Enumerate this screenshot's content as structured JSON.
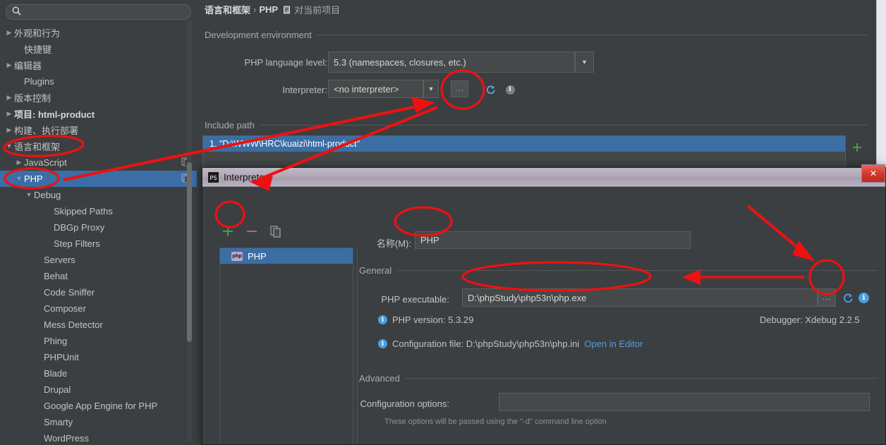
{
  "search": {
    "value": "",
    "placeholder": "",
    "icon": "search-icon"
  },
  "sidebar": {
    "items": [
      {
        "label": "外观和行为",
        "arrow": "▶",
        "indent": 0,
        "selected": false,
        "bold": false
      },
      {
        "label": "快捷键",
        "arrow": "",
        "indent": 1,
        "selected": false,
        "bold": false
      },
      {
        "label": "编辑器",
        "arrow": "▶",
        "indent": 0,
        "selected": false,
        "bold": false
      },
      {
        "label": "Plugins",
        "arrow": "",
        "indent": 1,
        "selected": false,
        "bold": false
      },
      {
        "label": "版本控制",
        "arrow": "▶",
        "indent": 0,
        "selected": false,
        "bold": false
      },
      {
        "label": "项目: html-product",
        "arrow": "▶",
        "indent": 0,
        "selected": false,
        "bold": true
      },
      {
        "label": "构建、执行部署",
        "arrow": "▶",
        "indent": 0,
        "selected": false,
        "bold": false
      },
      {
        "label": "语言和框架",
        "arrow": "▼",
        "indent": 0,
        "selected": false,
        "bold": false
      },
      {
        "label": "JavaScript",
        "arrow": "▶",
        "indent": 1,
        "selected": false,
        "bold": false,
        "tail": "copy-icon"
      },
      {
        "label": "PHP",
        "arrow": "▼",
        "indent": 1,
        "selected": true,
        "bold": false,
        "tail": "copy-icon"
      },
      {
        "label": "Debug",
        "arrow": "▼",
        "indent": 2,
        "selected": false,
        "bold": false
      },
      {
        "label": "Skipped Paths",
        "arrow": "",
        "indent": 4,
        "selected": false,
        "bold": false
      },
      {
        "label": "DBGp Proxy",
        "arrow": "",
        "indent": 4,
        "selected": false,
        "bold": false
      },
      {
        "label": "Step Filters",
        "arrow": "",
        "indent": 4,
        "selected": false,
        "bold": false
      },
      {
        "label": "Servers",
        "arrow": "",
        "indent": 3,
        "selected": false,
        "bold": false
      },
      {
        "label": "Behat",
        "arrow": "",
        "indent": 3,
        "selected": false,
        "bold": false
      },
      {
        "label": "Code Sniffer",
        "arrow": "",
        "indent": 3,
        "selected": false,
        "bold": false
      },
      {
        "label": "Composer",
        "arrow": "",
        "indent": 3,
        "selected": false,
        "bold": false
      },
      {
        "label": "Mess Detector",
        "arrow": "",
        "indent": 3,
        "selected": false,
        "bold": false
      },
      {
        "label": "Phing",
        "arrow": "",
        "indent": 3,
        "selected": false,
        "bold": false
      },
      {
        "label": "PHPUnit",
        "arrow": "",
        "indent": 3,
        "selected": false,
        "bold": false
      },
      {
        "label": "Blade",
        "arrow": "",
        "indent": 3,
        "selected": false,
        "bold": false
      },
      {
        "label": "Drupal",
        "arrow": "",
        "indent": 3,
        "selected": false,
        "bold": false
      },
      {
        "label": "Google App Engine for PHP",
        "arrow": "",
        "indent": 3,
        "selected": false,
        "bold": false
      },
      {
        "label": "Smarty",
        "arrow": "",
        "indent": 3,
        "selected": false,
        "bold": false
      },
      {
        "label": "WordPress",
        "arrow": "",
        "indent": 3,
        "selected": false,
        "bold": false
      }
    ]
  },
  "breadcrumb": {
    "parent": "语言和框架",
    "separator": "›",
    "current": "PHP",
    "scope": "对当前项目",
    "scope_icon": "project-scope-icon"
  },
  "main": {
    "dev_env_group": "Development environment",
    "lang_level_label": "PHP language level:",
    "lang_level_value": "5.3 (namespaces, closures, etc.)",
    "interpreter_label": "Interpreter:",
    "interpreter_value": "<no interpreter>",
    "browse_dots": "...",
    "include_path_group": "Include path",
    "include_path_rows": [
      "1. \"D:\\WWW\\HRC\\kuaizi\\html-product\""
    ],
    "add_symbol": "+"
  },
  "dialog": {
    "title": "Interpreters",
    "title_icon": "php-storm-icon",
    "close_label": "✕",
    "toolbar": {
      "add": "+",
      "remove": "−",
      "copy": "copy-icon"
    },
    "list": [
      {
        "label": "PHP",
        "icon": "php-icon",
        "selected": true
      }
    ],
    "name_label": "名称(M):",
    "name_value": "PHP",
    "general_group": "General",
    "executable_label": "PHP executable:",
    "executable_value": "D:\\phpStudy\\php53n\\php.exe",
    "executable_dots": "...",
    "php_version": "PHP version: 5.3.29",
    "debugger": "Debugger: Xdebug 2.2.5",
    "config_file": "Configuration file: D:\\phpStudy\\php53n\\php.ini",
    "config_file_link": "Open in Editor",
    "advanced_group": "Advanced",
    "config_options_label": "Configuration options:",
    "config_options_value": "",
    "config_options_hint": "These options will be passed using the ''-d'' command line option"
  },
  "colors": {
    "background": "#3c3f41",
    "selection": "#3a6ea5",
    "annotation": "#ee1111",
    "link": "#5b9bd5",
    "info": "#4a9fe0",
    "add_green": "#3f9e4d",
    "remove_red": "#c06060"
  }
}
